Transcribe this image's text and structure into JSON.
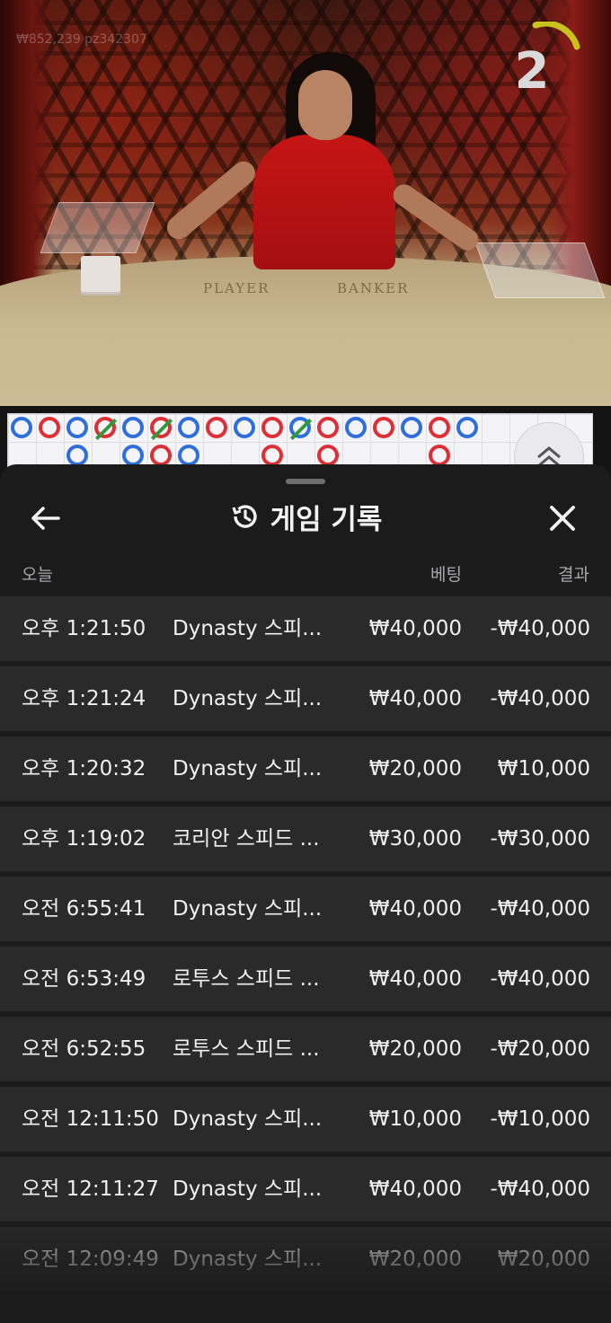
{
  "video": {
    "watermark": "₩852,239  pz342307",
    "countdown": "2",
    "table_labels": {
      "player": "PLAYER",
      "banker": "BANKER"
    }
  },
  "roadmap": {
    "beads": [
      {
        "col": 0,
        "row": 0,
        "r": "P"
      },
      {
        "col": 1,
        "row": 0,
        "r": "B"
      },
      {
        "col": 2,
        "row": 0,
        "r": "P"
      },
      {
        "col": 3,
        "row": 0,
        "r": "BT"
      },
      {
        "col": 4,
        "row": 0,
        "r": "P"
      },
      {
        "col": 5,
        "row": 0,
        "r": "BT"
      },
      {
        "col": 6,
        "row": 0,
        "r": "P"
      },
      {
        "col": 7,
        "row": 0,
        "r": "B"
      },
      {
        "col": 8,
        "row": 0,
        "r": "P"
      },
      {
        "col": 9,
        "row": 0,
        "r": "B"
      },
      {
        "col": 10,
        "row": 0,
        "r": "PT"
      },
      {
        "col": 11,
        "row": 0,
        "r": "B"
      },
      {
        "col": 12,
        "row": 0,
        "r": "P"
      },
      {
        "col": 13,
        "row": 0,
        "r": "B"
      },
      {
        "col": 14,
        "row": 0,
        "r": "P"
      },
      {
        "col": 15,
        "row": 0,
        "r": "B"
      },
      {
        "col": 16,
        "row": 0,
        "r": "P"
      },
      {
        "col": 2,
        "row": 1,
        "r": "P"
      },
      {
        "col": 4,
        "row": 1,
        "r": "P"
      },
      {
        "col": 5,
        "row": 1,
        "r": "B"
      },
      {
        "col": 6,
        "row": 1,
        "r": "P"
      },
      {
        "col": 9,
        "row": 1,
        "r": "B"
      },
      {
        "col": 11,
        "row": 1,
        "r": "B"
      },
      {
        "col": 15,
        "row": 1,
        "r": "B"
      }
    ],
    "colors": {
      "player": "#2f6fdc",
      "banker": "#dd2f35",
      "tie": "#2f9a3a"
    }
  },
  "history": {
    "title": "게임 기록",
    "back_icon": "arrow-left-icon",
    "history_icon": "history-icon",
    "close_icon": "close-icon",
    "columns": {
      "date": "오늘",
      "bet": "베팅",
      "result": "결과"
    },
    "rows": [
      {
        "time": "오후 1:21:50",
        "game": "Dynasty 스피...",
        "bet": "₩40,000",
        "result": "-₩40,000"
      },
      {
        "time": "오후 1:21:24",
        "game": "Dynasty 스피...",
        "bet": "₩40,000",
        "result": "-₩40,000"
      },
      {
        "time": "오후 1:20:32",
        "game": "Dynasty 스피...",
        "bet": "₩20,000",
        "result": "₩10,000"
      },
      {
        "time": "오후 1:19:02",
        "game": "코리안 스피드 ...",
        "bet": "₩30,000",
        "result": "-₩30,000"
      },
      {
        "time": "오전 6:55:41",
        "game": "Dynasty 스피...",
        "bet": "₩40,000",
        "result": "-₩40,000"
      },
      {
        "time": "오전 6:53:49",
        "game": "로투스 스피드 ...",
        "bet": "₩40,000",
        "result": "-₩40,000"
      },
      {
        "time": "오전 6:52:55",
        "game": "로투스 스피드 ...",
        "bet": "₩20,000",
        "result": "-₩20,000"
      },
      {
        "time": "오전 12:11:50",
        "game": "Dynasty 스피...",
        "bet": "₩10,000",
        "result": "-₩10,000"
      },
      {
        "time": "오전 12:11:27",
        "game": "Dynasty 스피...",
        "bet": "₩40,000",
        "result": "-₩40,000"
      },
      {
        "time": "오전 12:09:49",
        "game": "Dynasty 스피...",
        "bet": "₩20,000",
        "result": "₩20,000"
      }
    ]
  }
}
